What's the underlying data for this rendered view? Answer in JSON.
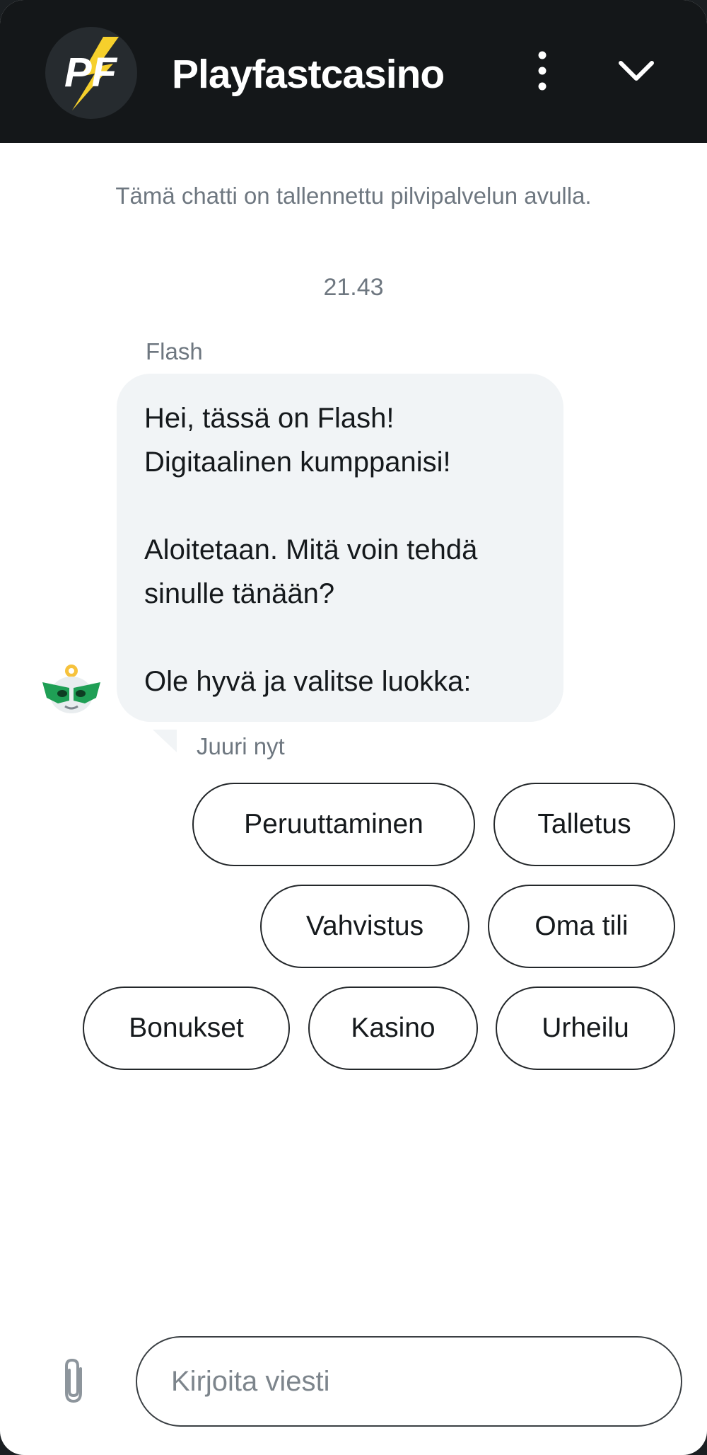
{
  "header": {
    "logo_text": "PF",
    "title": "Playfastcasino",
    "menu_icon": "vertical-dots-icon",
    "collapse_icon": "chevron-down-icon",
    "background_color": "#141719",
    "logo_accent_color": "#f6d02c"
  },
  "chat": {
    "notice": "Tämä chatti on tallennettu pilvipalvelun avulla.",
    "timestamp": "21.43",
    "message": {
      "sender": "Flash",
      "lines": [
        "Hei, tässä on Flash!",
        "Digitaalinen kumppanisi!",
        "Aloitetaan. Mitä voin tehdä",
        "sinulle tänään?",
        "Ole hyvä ja valitse luokka:"
      ],
      "time": "Juuri nyt",
      "avatar_icon": "bot-avatar-icon"
    },
    "options": [
      "Peruuttaminen",
      "Talletus",
      "Vahvistus",
      "Oma tili",
      "Bonukset",
      "Kasino",
      "Urheilu"
    ]
  },
  "composer": {
    "attach_icon": "paperclip-icon",
    "placeholder": "Kirjoita viesti",
    "value": ""
  }
}
